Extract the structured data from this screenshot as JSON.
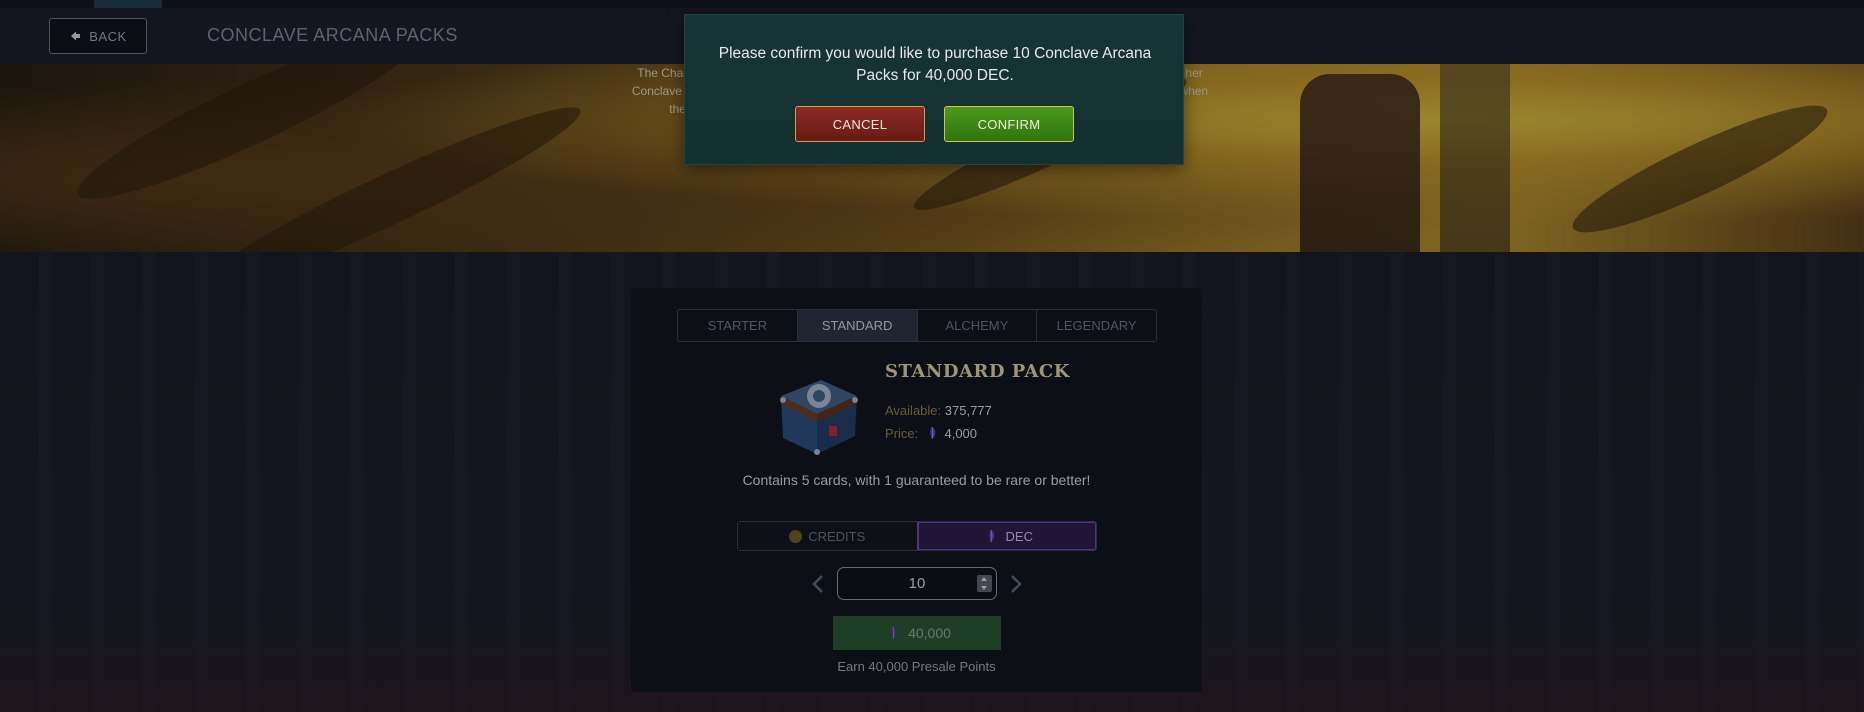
{
  "header": {
    "back_label": "BACK",
    "title": "CONCLAVE ARCANA PACKS"
  },
  "hero": {
    "lines": [
      "The Chaos Empire has fall                                                                                              d, Portia Nyr and her",
      "Conclave Arcana emerge fro                                                                                            t untapped—not when",
      "the world is                                                                                                                          s now."
    ]
  },
  "tabs": [
    {
      "label": "STARTER",
      "active": false
    },
    {
      "label": "STANDARD",
      "active": true
    },
    {
      "label": "ALCHEMY",
      "active": false
    },
    {
      "label": "LEGENDARY",
      "active": false
    }
  ],
  "pack": {
    "name": "STANDARD PACK",
    "available_label": "Available:",
    "available_value": "375,777",
    "price_label": "Price:",
    "price_value": "4,000",
    "contains": "Contains 5 cards, with 1 guaranteed to be rare or better!"
  },
  "currency": {
    "credits_label": "CREDITS",
    "dec_label": "DEC",
    "selected": "DEC"
  },
  "quantity": {
    "value": "10"
  },
  "purchase": {
    "button_label": "40,000",
    "earn_text": "Earn 40,000 Presale Points"
  },
  "modal": {
    "message": "Please confirm you would like to purchase 10 Conclave Arcana Packs for 40,000 DEC.",
    "cancel_label": "CANCEL",
    "confirm_label": "CONFIRM"
  },
  "colors": {
    "accent_dec": "#6e43b4",
    "confirm_green": "#3f8a16",
    "cancel_red": "#7a2220",
    "modal_bg": "#163537"
  },
  "icons": [
    "back-arrow-icon",
    "pack-chest-icon",
    "dec-gem-icon",
    "credits-coin-icon",
    "chevron-left-icon",
    "chevron-right-icon"
  ]
}
